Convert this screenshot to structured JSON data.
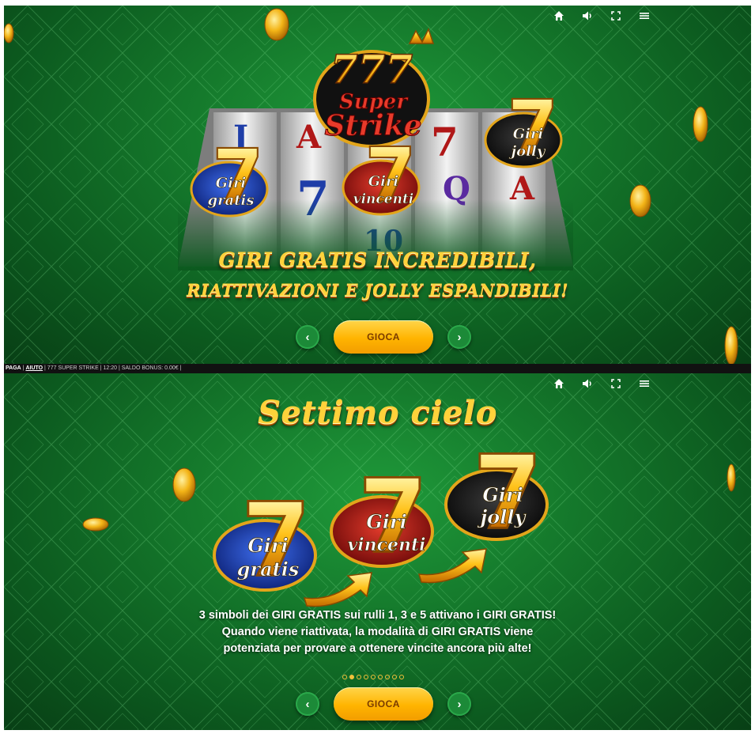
{
  "topbar": {
    "icons": [
      "home-icon",
      "sound-icon",
      "fullscreen-icon",
      "menu-icon"
    ]
  },
  "slide1": {
    "logo": {
      "line1": "777",
      "line2": "Super",
      "line3": "Strike"
    },
    "reels_symbols": [
      "J",
      "A",
      "7",
      "Q",
      "A",
      "7",
      "10"
    ],
    "badges": {
      "free_spins": [
        "Giri",
        "gratis"
      ],
      "winning_spins": [
        "Giri",
        "vincenti"
      ],
      "wild_spins": [
        "Giri",
        "jolly"
      ]
    },
    "headline_line1": "GIRI GRATIS INCREDIBILI,",
    "headline_line2": "RIATTIVAZIONI E JOLLY ESPANDIBILI!",
    "play_label": "GIOCA"
  },
  "info_bar": {
    "paga": "PAGA",
    "sep1": " | ",
    "aiuto": "AIUTO",
    "rest": " | 777 SUPER STRIKE | 12:20 | SALDO BONUS: 0.00€ |"
  },
  "slide2": {
    "title": "Settimo cielo",
    "badges": {
      "free_spins": [
        "Giri",
        "gratis"
      ],
      "winning_spins": [
        "Giri",
        "vincenti"
      ],
      "wild_spins": [
        "Giri",
        "jolly"
      ]
    },
    "description": [
      "3 simboli dei GIRI GRATIS sui rulli 1, 3 e 5 attivano i GIRI GRATIS!",
      "Quando viene riattivata, la modalità di GIRI GRATIS viene",
      "potenziata per provare a ottenere vincite ancora più alte!"
    ],
    "pagination": {
      "total": 9,
      "active": 2
    },
    "play_label": "GIOCA"
  },
  "colors": {
    "felt_green": "#157a2c",
    "gold": "#ffd23a",
    "badge_blue": "#1e3fa8",
    "badge_red": "#b21a1a",
    "badge_black": "#1a1a1a",
    "button_green": "#1c8a38",
    "play_orange": "#ffb400"
  }
}
